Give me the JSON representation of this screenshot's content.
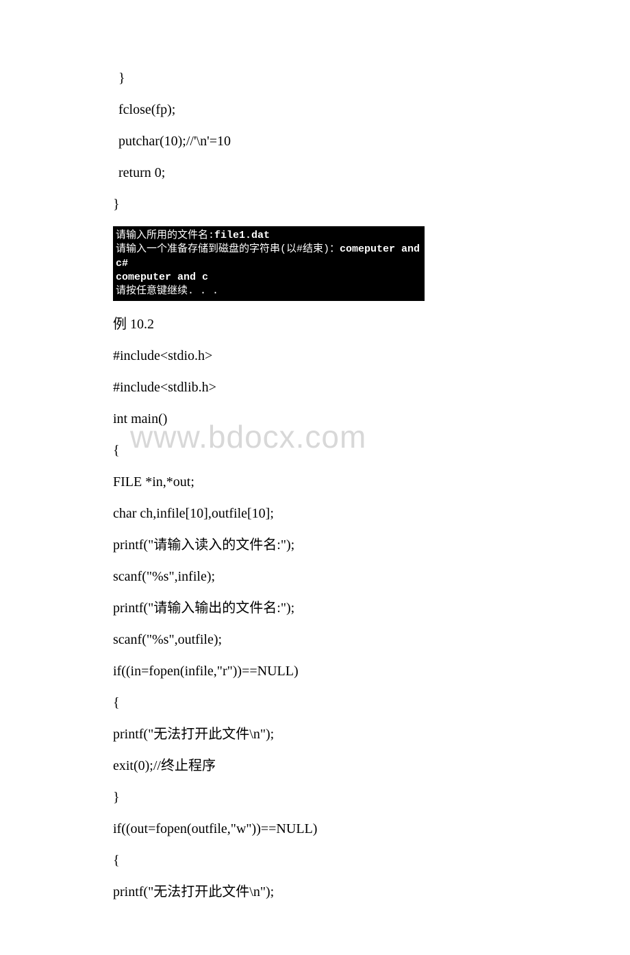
{
  "watermark": "www.bdocx.com",
  "codeTop": [
    " }",
    " fclose(fp);",
    " putchar(10);//'\\n'=10",
    " return 0;",
    "}"
  ],
  "console": {
    "l1a": "请输入所用的文件名:",
    "l1b": "file1.dat",
    "l2a": "请输入一个准备存储到磁盘的字符串(以#结束)：",
    "l2b": "comeputer and c#",
    "l3": "comeputer and c",
    "l4": "请按任意键继续. . ."
  },
  "exTitle": "例 10.2",
  "codeMain": [
    "#include<stdio.h>",
    "#include<stdlib.h>",
    "int main()",
    "{",
    " FILE *in,*out;",
    " char ch,infile[10],outfile[10];",
    " printf(\"请输入读入的文件名:\");",
    " scanf(\"%s\",infile);",
    " printf(\"请输入输出的文件名:\");",
    " scanf(\"%s\",outfile);",
    " if((in=fopen(infile,\"r\"))==NULL)",
    " {",
    "  printf(\"无法打开此文件\\n\");",
    "  exit(0);//终止程序",
    " }",
    " if((out=fopen(outfile,\"w\"))==NULL)",
    " {",
    "  printf(\"无法打开此文件\\n\");"
  ]
}
